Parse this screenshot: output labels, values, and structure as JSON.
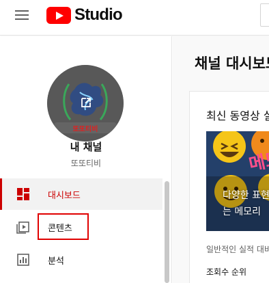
{
  "header": {
    "logo_text": "Studio",
    "menu_icon": "hamburger-menu-icon",
    "logo_icon": "youtube-play-icon"
  },
  "sidebar": {
    "channel_title": "내 채널",
    "channel_name": "또또티비",
    "avatar_text": "또또티비",
    "avatar_overlay_icon": "external-link-icon",
    "items": [
      {
        "label": "대시보드",
        "icon": "dashboard-icon",
        "active": true
      },
      {
        "label": "콘텐츠",
        "icon": "content-icon",
        "active": false
      },
      {
        "label": "분석",
        "icon": "analytics-icon",
        "active": false
      }
    ]
  },
  "main": {
    "page_title": "채널 대시보드",
    "card": {
      "title": "최신 동영상 실적",
      "thumbnail_line1": "다양한 표현",
      "thumbnail_line2": "는 메모리",
      "thumbnail_overlay": "메모",
      "subtitle": "일반적인 실적 대비",
      "row_label": "조회수 순위"
    }
  },
  "colors": {
    "brand_red": "#ff0000",
    "active_red": "#cc0000",
    "highlight_red": "#e00000",
    "active_bg": "#f2f2f2",
    "main_bg": "#f9f9f9"
  }
}
